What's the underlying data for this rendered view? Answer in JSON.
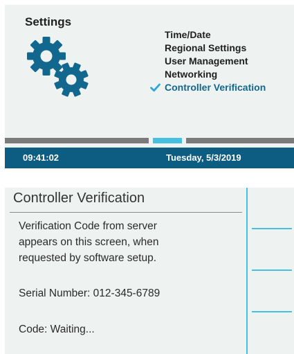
{
  "settings_screen": {
    "title": "Settings",
    "icon": "gears-icon",
    "menu_items": [
      {
        "label": "Time/Date",
        "selected": false
      },
      {
        "label": "Regional Settings",
        "selected": false
      },
      {
        "label": "User Management",
        "selected": false
      },
      {
        "label": "Networking",
        "selected": false
      },
      {
        "label": "Controller Verification",
        "selected": true
      }
    ],
    "status_bar": {
      "time": "09:41:02",
      "date": "Tuesday, 5/3/2019"
    },
    "colors": {
      "accent": "#44c0e0",
      "status_bar": "#0d5c81",
      "selected_text": "#11678e",
      "inactive_segment": "#7a7a7a"
    }
  },
  "verification_screen": {
    "title": "Controller Verification",
    "description_lines": [
      "Verification Code from server",
      "appears on this screen, when",
      "requested by software setup."
    ],
    "serial_number": "Serial Number: 012-345-6789",
    "code_status": "Code: Waiting..."
  }
}
